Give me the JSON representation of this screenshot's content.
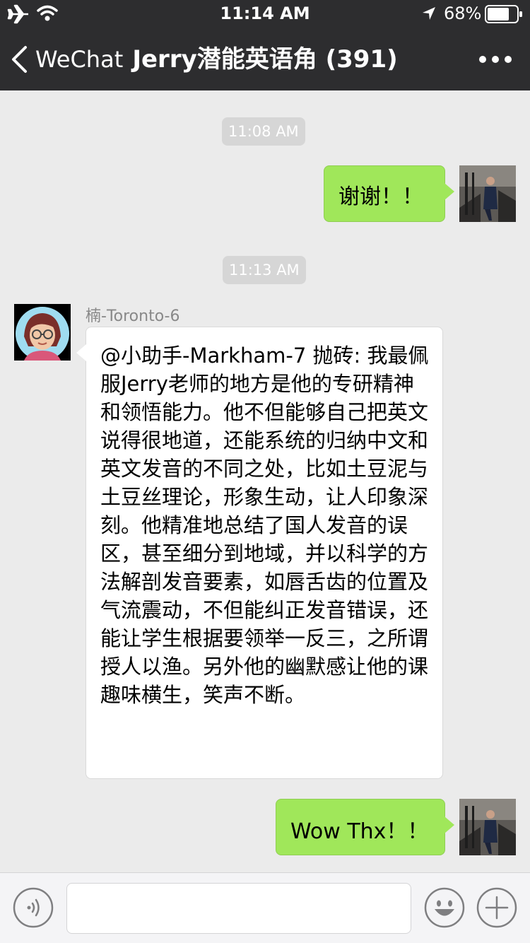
{
  "status_bar": {
    "time": "11:14 AM",
    "battery_percent": "68%",
    "icons": [
      "airplane-icon",
      "wifi-icon",
      "location-arrow-icon",
      "battery-icon"
    ]
  },
  "nav": {
    "back_label": "WeChat",
    "title": "Jerry潜能英语角 (391)",
    "more_icon": "more-dots-icon"
  },
  "messages": {
    "time_1": "11:08 AM",
    "me_1": "谢谢！！",
    "time_2": "11:13 AM",
    "other_sender": "楠-Toronto-6",
    "other_text": "@小助手-Markham-7 抛砖: 我最佩服Jerry老师的地方是他的专研精神和领悟能力。他不但能够自己把英文说得很地道，还能系统的归纳中文和英文发音的不同之处，比如土豆泥与土豆丝理论，形象生动，让人印象深刻。他精准地总结了国人发音的误区，甚至细分到地域，并以科学的方法解剖发音要素，如唇舌齿的位置及气流震动，不但能纠正发音错误，还能让学生根据要领举一反三，之所谓授人以渔。另外他的幽默感让他的课趣味横生，笑声不断。",
    "me_2": "Wow Thx！！"
  },
  "input_bar": {
    "text_value": "",
    "icons": [
      "voice-icon",
      "emoji-icon",
      "plus-icon"
    ]
  },
  "colors": {
    "nav_background": "#2d2d2f",
    "chat_background": "#ebebeb",
    "my_bubble": "#a0e75a",
    "other_bubble": "#ffffff",
    "time_pill": "#d6d6d6"
  }
}
